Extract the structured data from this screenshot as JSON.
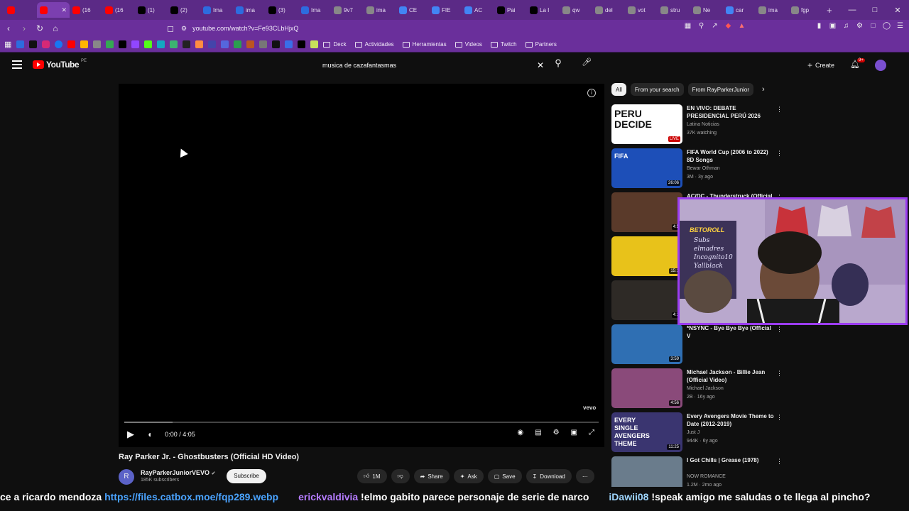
{
  "browser": {
    "tabs": [
      {
        "label": "",
        "icon": "youtube-icon",
        "color": "#ff0000"
      },
      {
        "label": "",
        "icon": "youtube-icon",
        "color": "#ff0000",
        "active": true
      },
      {
        "label": "(16",
        "icon": "youtube-icon",
        "color": "#ff0000"
      },
      {
        "label": "(16",
        "icon": "youtube-icon",
        "color": "#ff0000"
      },
      {
        "label": "(1)",
        "icon": "x-icon",
        "color": "#000000"
      },
      {
        "label": "(2)",
        "icon": "tiktok-icon",
        "color": "#000000"
      },
      {
        "label": "Ima",
        "icon": "p-icon",
        "color": "#2d6cdf"
      },
      {
        "label": "ima",
        "icon": "p-icon",
        "color": "#2d6cdf"
      },
      {
        "label": "(3)",
        "icon": "tiktok-icon",
        "color": "#000000"
      },
      {
        "label": "Ima",
        "icon": "p-icon",
        "color": "#2d6cdf"
      },
      {
        "label": "9v7",
        "icon": "web-icon",
        "color": "#888888"
      },
      {
        "label": "ima",
        "icon": "web-icon",
        "color": "#888888"
      },
      {
        "label": "CE",
        "icon": "google-icon",
        "color": "#4285f4"
      },
      {
        "label": "FIE",
        "icon": "google-icon",
        "color": "#4285f4"
      },
      {
        "label": "AC",
        "icon": "google-icon",
        "color": "#4285f4"
      },
      {
        "label": "Pai",
        "icon": "tiktok-icon",
        "color": "#000000"
      },
      {
        "label": "La I",
        "icon": "tiktok-icon",
        "color": "#000000"
      },
      {
        "label": "qw",
        "icon": "web-icon",
        "color": "#888888"
      },
      {
        "label": "del",
        "icon": "web-icon",
        "color": "#888888"
      },
      {
        "label": "vot",
        "icon": "web-icon",
        "color": "#888888"
      },
      {
        "label": "stru",
        "icon": "web-icon",
        "color": "#888888"
      },
      {
        "label": "Ne",
        "icon": "shield-icon",
        "color": "#888888"
      },
      {
        "label": "car",
        "icon": "google-icon",
        "color": "#4285f4"
      },
      {
        "label": "ima",
        "icon": "web-icon",
        "color": "#888888"
      },
      {
        "label": "fgp",
        "icon": "web-icon",
        "color": "#888888"
      }
    ],
    "url": "youtube.com/watch?v=Fe93CLbHjxQ",
    "bookmarks": [
      {
        "label": "Deck"
      },
      {
        "label": "Actividades"
      },
      {
        "label": "Herramientas"
      },
      {
        "label": "Videos"
      },
      {
        "label": "Twitch"
      },
      {
        "label": "Partners"
      }
    ]
  },
  "youtube": {
    "logo_text": "YouTube",
    "logo_country": "PE",
    "search_query": "musica de cazafantasmas",
    "create_label": "Create",
    "notif_count": "9+"
  },
  "player": {
    "time": "0:00 / 4:05",
    "progress": 0.0,
    "watermark": "vevo"
  },
  "video": {
    "title": "Ray Parker Jr. - Ghostbusters (Official HD Video)",
    "channel_initial": "R",
    "channel": "RayParkerJuniorVEVO",
    "subscribers": "185K subscribers",
    "subscribe_label": "Subscribe",
    "actions": {
      "like": "1M",
      "share": "Share",
      "ask": "Ask",
      "save": "Save",
      "download": "Download"
    }
  },
  "chips": [
    "All",
    "From your search",
    "From RayParkerJunior"
  ],
  "recommendations": [
    {
      "title": "EN VIVO: DEBATE PRESIDENCIAL PERÚ 2026",
      "channel": "Latina Noticias",
      "meta": "37K watching",
      "badge": "LIVE",
      "thumb_text": "PERU DECIDE",
      "thumb_color": "#ffffff"
    },
    {
      "title": "FIFA World Cup (2006 to 2022) 8D Songs",
      "channel": "Bewar Othman",
      "meta": "3M · 3y ago",
      "badge": "26:06",
      "thumb_text": "FIFA",
      "thumb_color": "#1d4fb8"
    },
    {
      "title": "AC/DC - Thunderstruck (Official",
      "channel": "",
      "meta": "",
      "badge": "4:5",
      "thumb_text": "",
      "thumb_color": "#5a3a2a"
    },
    {
      "title": "",
      "channel": "",
      "meta": "",
      "badge": "15:1",
      "thumb_text": "",
      "thumb_color": "#e8c21a"
    },
    {
      "title": "",
      "channel": "",
      "meta": "",
      "badge": "4:1",
      "thumb_text": "",
      "thumb_color": "#2e2a26"
    },
    {
      "title": "*NSYNC - Bye Bye Bye (Official V",
      "channel": "",
      "meta": "",
      "badge": "3:59",
      "thumb_text": "",
      "thumb_color": "#2f6fb3"
    },
    {
      "title": "Michael Jackson - Billie Jean (Official Video)",
      "channel": "Michael Jackson",
      "meta": "2B · 16y ago",
      "badge": "4:56",
      "thumb_text": "",
      "thumb_color": "#8a4a7a"
    },
    {
      "title": "Every Avengers Movie Theme to Date (2012-2019)",
      "channel": "Just J",
      "meta": "944K · 6y ago",
      "badge": "11:25",
      "thumb_text": "EVERY SINGLE AVENGERS THEME",
      "thumb_color": "#3a3570"
    },
    {
      "title": "I Got Chills | Grease (1978)",
      "channel": "NOW ROMANCE",
      "meta": "1.2M · 2mo ago",
      "badge": "",
      "thumb_text": "",
      "thumb_color": "#6a7c8c"
    }
  ],
  "webcam": {
    "overlay_tag": "BETOROLL",
    "overlay_lines": [
      "Subs",
      "elmadres",
      "Incognito10",
      "Yallblack"
    ]
  },
  "chat": {
    "segments": [
      {
        "kind": "msg",
        "text": "ce a ricardo mendoza "
      },
      {
        "kind": "link",
        "text": "https://files.catbox.moe/fqp289.webp"
      },
      {
        "kind": "nick",
        "text": "erickvaldivia"
      },
      {
        "kind": "msg",
        "text": " !elmo gabito parece personaje de serie de narco"
      },
      {
        "kind": "nick2",
        "text": "iDawii08"
      },
      {
        "kind": "msg",
        "text": " !speak amigo me saludas o te llega al pincho?"
      }
    ]
  }
}
